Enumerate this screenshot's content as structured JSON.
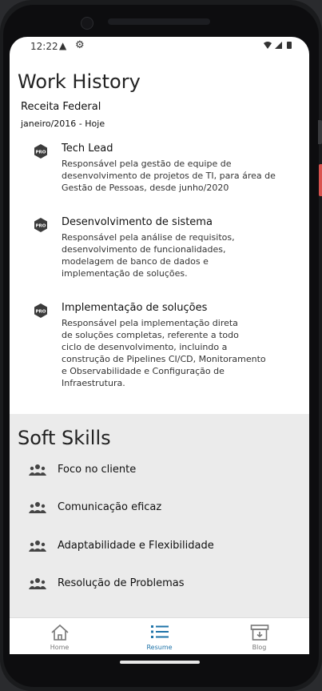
{
  "status": {
    "time": "12:22",
    "warn_icon": "warning-icon",
    "settings_icon": "settings-icon"
  },
  "work_history": {
    "title": "Work History",
    "company": "Receita Federal",
    "period": "janeiro/2016 - Hoje",
    "badge_text": "PRO",
    "jobs": [
      {
        "title": "Tech Lead",
        "lines": [
          "Responsável pela gestão de equipe de",
          "desenvolvimento de projetos de TI, para área de",
          "Gestão de Pessoas, desde junho/2020"
        ]
      },
      {
        "title": "Desenvolvimento de sistema",
        "lines": [
          "Responsável pela análise de requisitos,",
          "desenvolvimento de funcionalidades,",
          "modelagem de banco de dados e",
          "implementação de soluções."
        ]
      },
      {
        "title": "Implementação de soluções",
        "lines": [
          "Responsável pela implementação direta",
          "de soluções completas, referente a todo",
          "ciclo de desenvolvimento, incluindo a",
          "construção de Pipelines CI/CD, Monitoramento",
          "e Observabilidade e Configuração de",
          "Infraestrutura."
        ]
      }
    ]
  },
  "soft_skills": {
    "title": "Soft Skills",
    "items": [
      "Foco no cliente",
      "Comunicação eficaz",
      "Adaptabilidade e Flexibilidade",
      "Resolução de Problemas"
    ]
  },
  "nav": {
    "items": [
      {
        "label": "Home",
        "icon": "home-icon"
      },
      {
        "label": "Resume",
        "icon": "list-icon",
        "active": true
      },
      {
        "label": "Blog",
        "icon": "archive-icon"
      }
    ]
  },
  "colors": {
    "accent": "#1e73a8",
    "soft_bg": "#ebebeb"
  }
}
